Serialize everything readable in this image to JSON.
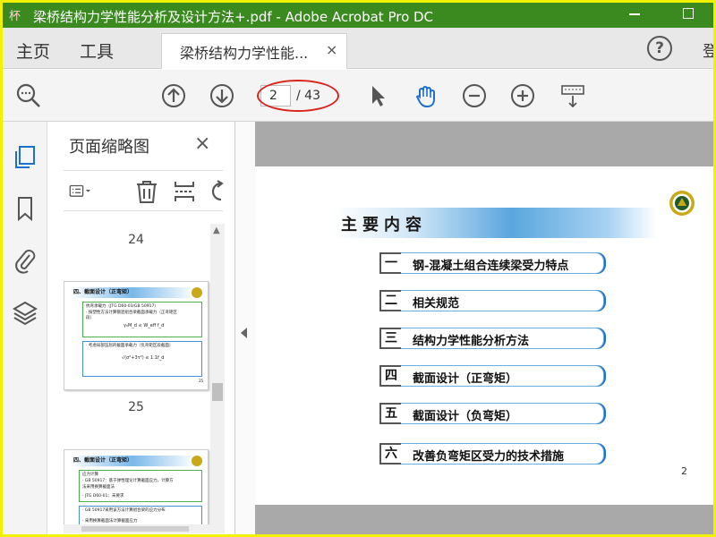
{
  "window": {
    "title": "梁桥结构力学性能分析及设计方法+.pdf - Adobe Acrobat Pro DC",
    "logo_text": "ぐ杯网"
  },
  "menu": {
    "home": "主页",
    "tools": "工具",
    "tab_label": "梁桥结构力学性能...",
    "tab_close": "×",
    "help": "?",
    "signin": "登"
  },
  "toolbar": {
    "current_page": "2",
    "total_pages": "/ 43"
  },
  "panel": {
    "title": "页面缩略图",
    "close": "×",
    "thumbnails": [
      {
        "number": "24",
        "heading": "四、截面设计（正弯矩）",
        "lines": [
          "抗弯承载力（JTG D60-03/GB 50917）",
          "·  按塑性方法计算钢混组合梁截面承载力（正弯矩区",
          "    段）",
          "·  考虑局部压屈的截面承载力（负弯矩区段截面）"
        ],
        "formula": "γ₀M_d ≤ W_eff f_d",
        "formula2": "√(σ²+3τ²) ≤ 1.1f_d",
        "page": "25"
      },
      {
        "number": "25",
        "heading": "四、截面设计（正弯矩）",
        "lines": [
          "应力计算",
          "·  GB 50917：基于弹性理论计算截面应力，计算方",
          "    法采用换算截面法",
          "·  JTG D60-01：未要求",
          "·  GB 50917采用该方法计算组合梁的应力分布",
          "·  采用换算截面法计算截面应力"
        ],
        "page": "25"
      }
    ]
  },
  "slide": {
    "title": "主要内容",
    "page_number": "2",
    "items": [
      {
        "num": "一",
        "text": "钢-混凝土组合连续梁受力特点"
      },
      {
        "num": "二",
        "text": "相关规范"
      },
      {
        "num": "三",
        "text": "结构力学性能分析方法"
      },
      {
        "num": "四",
        "text": "截面设计（正弯矩）"
      },
      {
        "num": "五",
        "text": "截面设计（负弯矩）"
      },
      {
        "num": "六",
        "text": "改善负弯矩区受力的技术措施"
      }
    ]
  },
  "colors": {
    "title_bar": "#3a8a20",
    "accent_blue": "#1d6fd0",
    "highlight_red": "#d8261e",
    "outer_border": "#f2f200"
  }
}
